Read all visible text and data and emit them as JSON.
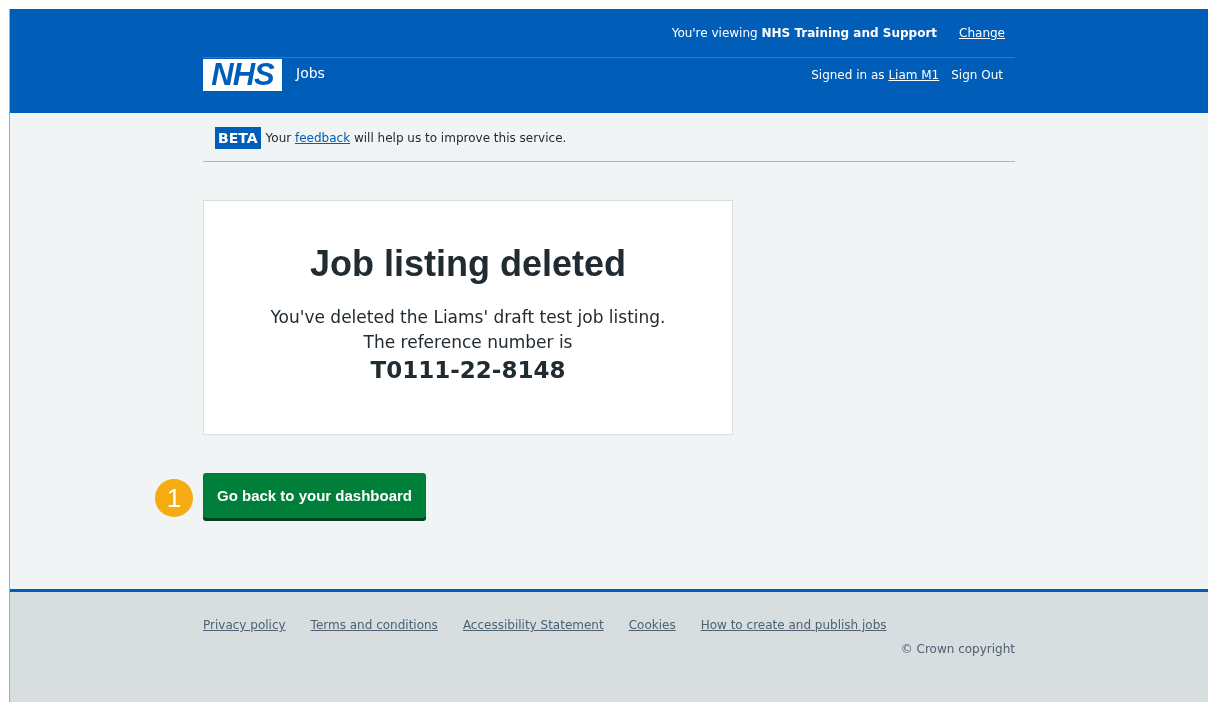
{
  "header": {
    "logo": "NHS",
    "service": "Jobs",
    "viewing": "You're viewing **NHS Training and Support**",
    "change_link": "Change",
    "signed_in_prefix": "Signed in as",
    "user_link": "Liam M1",
    "sign_out": "Sign Out"
  },
  "phase_banner": {
    "tag": "BETA",
    "before": "Your",
    "link": "feedback",
    "after": "will help us to improve this service."
  },
  "panel": {
    "title": "Job listing deleted",
    "body": "You've deleted the Liams' draft test job listing.",
    "reference_label": "The reference number is",
    "reference": "T0111-22-8148"
  },
  "step_marker": "1",
  "button": "Go back to your dashboard",
  "footer": {
    "links": [
      "Privacy policy",
      "Terms and conditions",
      "Accessibility Statement",
      "Cookies",
      "How to create and publish jobs"
    ],
    "copyright": "© Crown copyright"
  }
}
